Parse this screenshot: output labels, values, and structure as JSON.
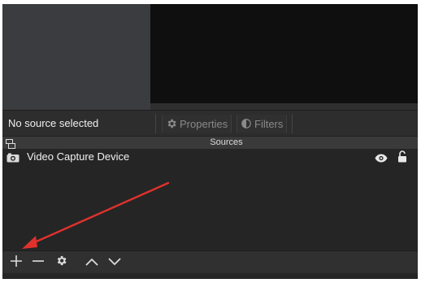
{
  "context_bar": {
    "status_text": "No source selected",
    "properties_label": "Properties",
    "filters_label": "Filters"
  },
  "sources_panel": {
    "title": "Sources",
    "items": [
      {
        "name": "Video Capture Device",
        "icon": "camera-icon",
        "visible": true,
        "locked": false
      }
    ]
  },
  "toolbar": {
    "icons": [
      "add-icon",
      "remove-icon",
      "gear-icon",
      "chevron-up-icon",
      "chevron-down-icon"
    ]
  },
  "annotation": {
    "arrow_color": "#e0312c"
  }
}
